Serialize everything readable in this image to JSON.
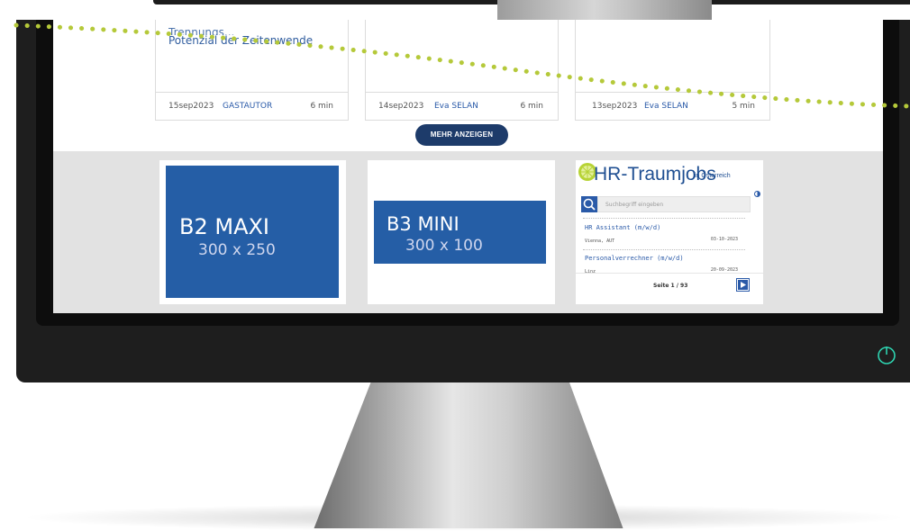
{
  "articles": [
    {
      "title_partial": "Trennungs...",
      "title": "Potenzial der Zeitenwende",
      "date": "15sep2023",
      "author": "GASTAUTOR",
      "read_time": "6 min"
    },
    {
      "title_partial": "",
      "title": "",
      "date": "14sep2023",
      "author": "Eva SELAN",
      "read_time": "6 min"
    },
    {
      "title_partial": "",
      "title": "",
      "date": "13sep2023",
      "author": "Eva SELAN",
      "read_time": "5 min"
    }
  ],
  "more_button": "MEHR ANZEIGEN",
  "ads": {
    "b2": {
      "name": "B2 MAXI",
      "size": "300 x 250"
    },
    "b3": {
      "name": "B3 MINI",
      "size": "300 x 100"
    }
  },
  "hr_widget": {
    "logo": "HR-Traumjobs",
    "logo_sub": "in Österreich",
    "search_placeholder": "Suchbegriff eingeben",
    "jobs": [
      {
        "title": "HR Assistant (m/w/d)",
        "location": "Vienna, AUT",
        "date": "03-10-2023"
      },
      {
        "title": "Personalverrechner (m/w/d)",
        "location": "Linz",
        "date": "20-09-2023"
      }
    ],
    "pagination": "Seite 1 / 93"
  },
  "colors": {
    "brand_blue": "#255ea6",
    "button_navy": "#1d3b6a",
    "dot_green": "#b5c93a",
    "power_teal": "#2ed3b0"
  }
}
